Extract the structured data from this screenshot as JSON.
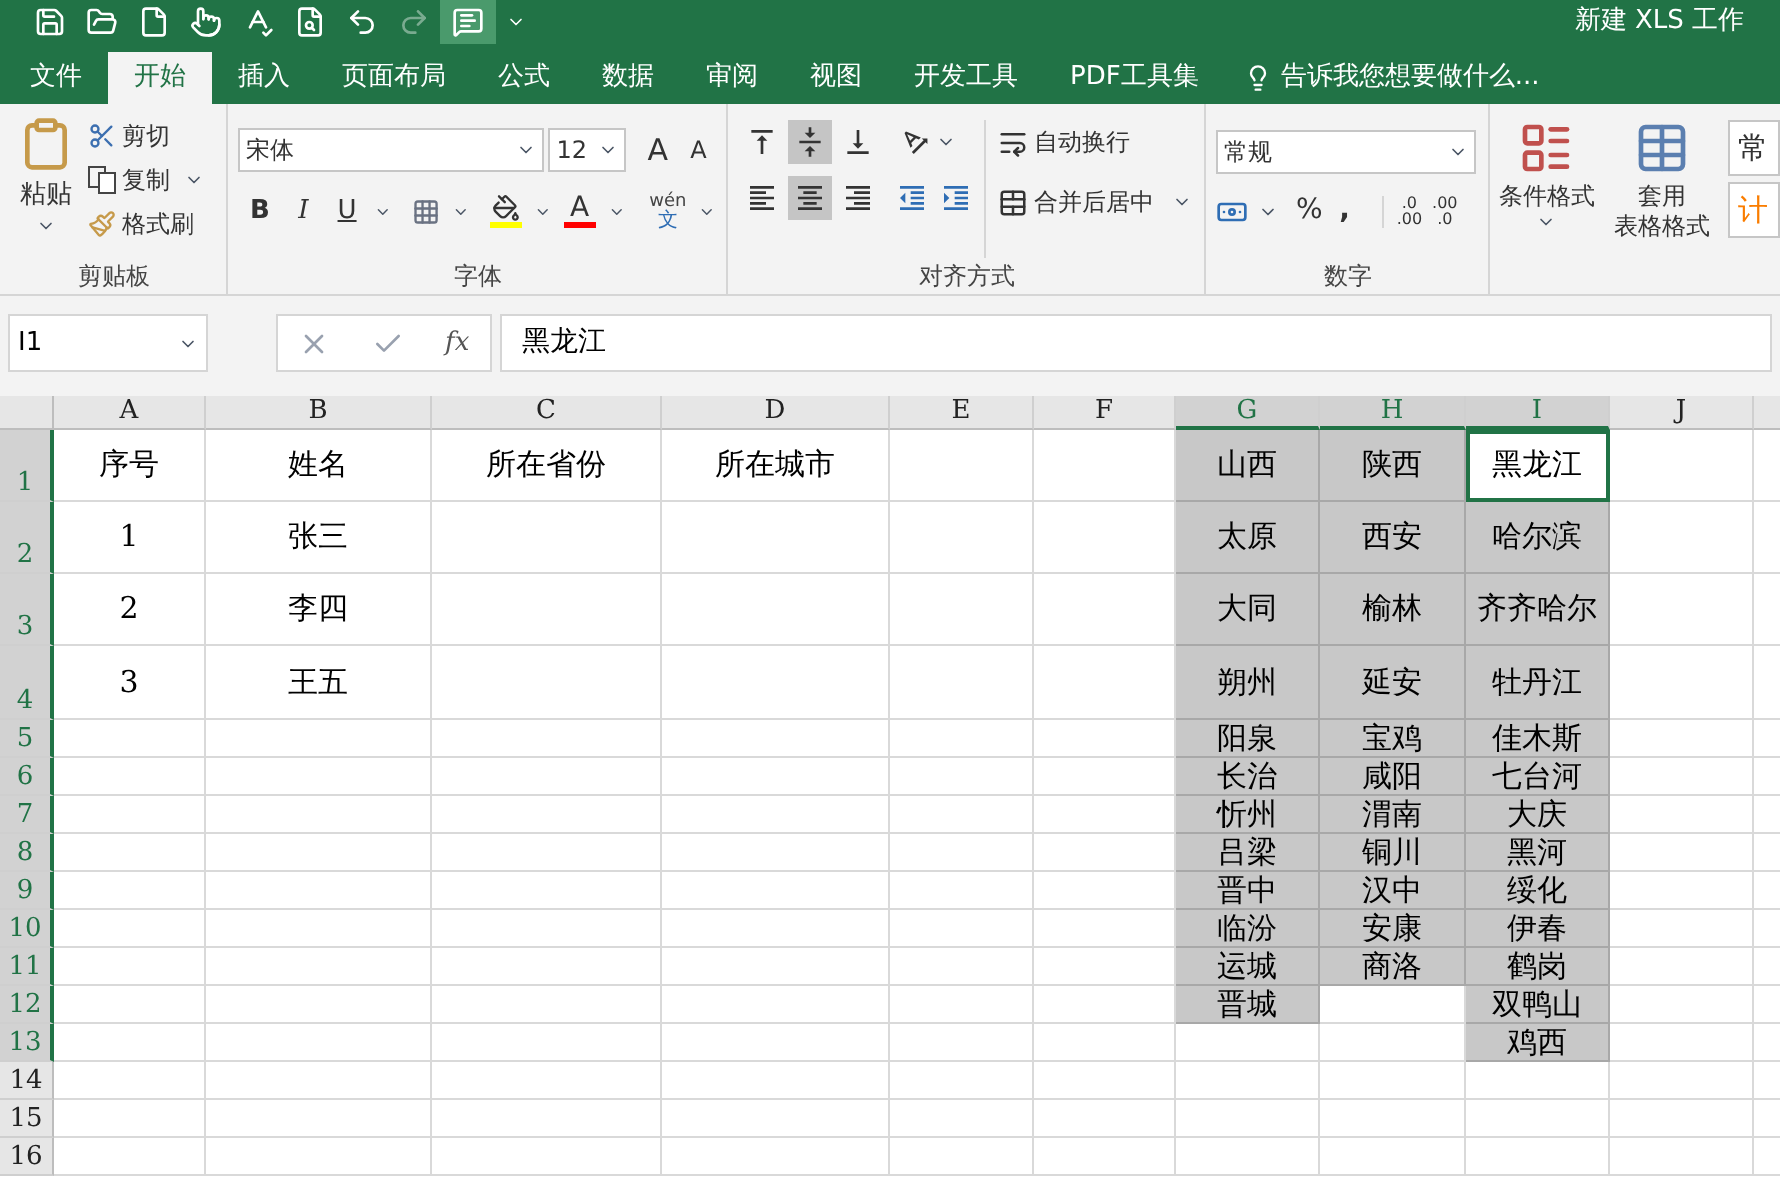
{
  "window": {
    "title": "新建 XLS 工作"
  },
  "tabs": [
    {
      "label": "文件",
      "selected": false
    },
    {
      "label": "开始",
      "selected": true
    },
    {
      "label": "插入",
      "selected": false
    },
    {
      "label": "页面布局",
      "selected": false
    },
    {
      "label": "公式",
      "selected": false
    },
    {
      "label": "数据",
      "selected": false
    },
    {
      "label": "审阅",
      "selected": false
    },
    {
      "label": "视图",
      "selected": false
    },
    {
      "label": "开发工具",
      "selected": false
    },
    {
      "label": "PDF工具集",
      "selected": false
    }
  ],
  "tell_me": {
    "placeholder": "告诉我您想要做什么..."
  },
  "ribbon": {
    "clipboard": {
      "label": "剪贴板",
      "paste": "粘贴",
      "cut": "剪切",
      "copy": "复制",
      "format_painter": "格式刷"
    },
    "font": {
      "label": "字体",
      "font_name": "宋体",
      "font_size": "12",
      "grow": "A",
      "shrink": "A",
      "bold": "B",
      "italic": "I",
      "underline": "U",
      "font_color": "A",
      "phonetic": [
        "wén",
        "文"
      ]
    },
    "alignment": {
      "label": "对齐方式",
      "vertical": [
        {
          "selected": false
        },
        {
          "selected": true
        },
        {
          "selected": false
        }
      ],
      "horizontal": [
        {
          "selected": false
        },
        {
          "selected": true
        },
        {
          "selected": false
        }
      ],
      "wrap": "自动换行",
      "merge": "合并后居中"
    },
    "number": {
      "label": "数字",
      "format": "常规",
      "percent": "%",
      "comma": ",",
      "increase_decimal": [
        ".0",
        ".00"
      ],
      "decrease_decimal": [
        ".00",
        ".0"
      ]
    },
    "styles": {
      "conditional": "条件格式",
      "table_format": [
        "套用",
        "表格格式"
      ],
      "cell_styles": [
        "常",
        "计"
      ]
    }
  },
  "formula_bar": {
    "name_box": "I1",
    "fx": "fx",
    "value": "黑龙江"
  },
  "sheet": {
    "columns": [
      {
        "label": "A",
        "selected": false
      },
      {
        "label": "B",
        "selected": false
      },
      {
        "label": "C",
        "selected": false
      },
      {
        "label": "D",
        "selected": false
      },
      {
        "label": "E",
        "selected": false
      },
      {
        "label": "F",
        "selected": false
      },
      {
        "label": "G",
        "selected": true
      },
      {
        "label": "H",
        "selected": true
      },
      {
        "label": "I",
        "selected": true
      },
      {
        "label": "J",
        "selected": false
      }
    ],
    "rows": [
      {
        "number": "1",
        "selected": true,
        "cells": [
          {
            "text": "序号"
          },
          {
            "text": "姓名"
          },
          {
            "text": "所在省份"
          },
          {
            "text": "所在城市"
          },
          {},
          {},
          {
            "text": "山西",
            "shaded": true
          },
          {
            "text": "陕西",
            "shaded": true
          },
          {
            "text": "黑龙江",
            "active": true
          }
        ]
      },
      {
        "number": "2",
        "selected": true,
        "cells": [
          {
            "text": "1"
          },
          {
            "text": "张三"
          },
          {},
          {},
          {},
          {},
          {
            "text": "太原",
            "shaded": true
          },
          {
            "text": "西安",
            "shaded": true
          },
          {
            "text": "哈尔滨",
            "shaded": true
          }
        ]
      },
      {
        "number": "3",
        "selected": true,
        "cells": [
          {
            "text": "2"
          },
          {
            "text": "李四"
          },
          {},
          {},
          {},
          {},
          {
            "text": "大同",
            "shaded": true
          },
          {
            "text": "榆林",
            "shaded": true
          },
          {
            "text": "齐齐哈尔",
            "shaded": true
          }
        ]
      },
      {
        "number": "4",
        "selected": true,
        "cells": [
          {
            "text": "3"
          },
          {
            "text": "王五"
          },
          {},
          {},
          {},
          {},
          {
            "text": "朔州",
            "shaded": true
          },
          {
            "text": "延安",
            "shaded": true
          },
          {
            "text": "牡丹江",
            "shaded": true
          }
        ]
      },
      {
        "number": "5",
        "selected": true,
        "cells": [
          {},
          {},
          {},
          {},
          {},
          {},
          {
            "text": "阳泉",
            "shaded": true
          },
          {
            "text": "宝鸡",
            "shaded": true
          },
          {
            "text": "佳木斯",
            "shaded": true
          }
        ]
      },
      {
        "number": "6",
        "selected": true,
        "cells": [
          {},
          {},
          {},
          {},
          {},
          {},
          {
            "text": "长治",
            "shaded": true
          },
          {
            "text": "咸阳",
            "shaded": true
          },
          {
            "text": "七台河",
            "shaded": true
          }
        ]
      },
      {
        "number": "7",
        "selected": true,
        "cells": [
          {},
          {},
          {},
          {},
          {},
          {},
          {
            "text": "忻州",
            "shaded": true
          },
          {
            "text": "渭南",
            "shaded": true
          },
          {
            "text": "大庆",
            "shaded": true
          }
        ]
      },
      {
        "number": "8",
        "selected": true,
        "cells": [
          {},
          {},
          {},
          {},
          {},
          {},
          {
            "text": "吕梁",
            "shaded": true
          },
          {
            "text": "铜川",
            "shaded": true
          },
          {
            "text": "黑河",
            "shaded": true
          }
        ]
      },
      {
        "number": "9",
        "selected": true,
        "cells": [
          {},
          {},
          {},
          {},
          {},
          {},
          {
            "text": "晋中",
            "shaded": true
          },
          {
            "text": "汉中",
            "shaded": true
          },
          {
            "text": "绥化",
            "shaded": true
          }
        ]
      },
      {
        "number": "10",
        "selected": true,
        "cells": [
          {},
          {},
          {},
          {},
          {},
          {},
          {
            "text": "临汾",
            "shaded": true
          },
          {
            "text": "安康",
            "shaded": true
          },
          {
            "text": "伊春",
            "shaded": true
          }
        ]
      },
      {
        "number": "11",
        "selected": true,
        "cells": [
          {},
          {},
          {},
          {},
          {},
          {},
          {
            "text": "运城",
            "shaded": true
          },
          {
            "text": "商洛",
            "shaded": true
          },
          {
            "text": "鹤岗",
            "shaded": true
          }
        ]
      },
      {
        "number": "12",
        "selected": true,
        "cells": [
          {},
          {},
          {},
          {},
          {},
          {},
          {
            "text": "晋城",
            "shaded": true
          },
          {},
          {
            "text": "双鸭山",
            "shaded": true
          }
        ]
      },
      {
        "number": "13",
        "selected": true,
        "cells": [
          {},
          {},
          {},
          {},
          {},
          {},
          {},
          {},
          {
            "text": "鸡西",
            "shaded": true
          }
        ]
      },
      {
        "number": "14",
        "selected": false,
        "cells": []
      },
      {
        "number": "15",
        "selected": false,
        "cells": []
      },
      {
        "number": "16",
        "selected": false,
        "cells": []
      }
    ]
  }
}
